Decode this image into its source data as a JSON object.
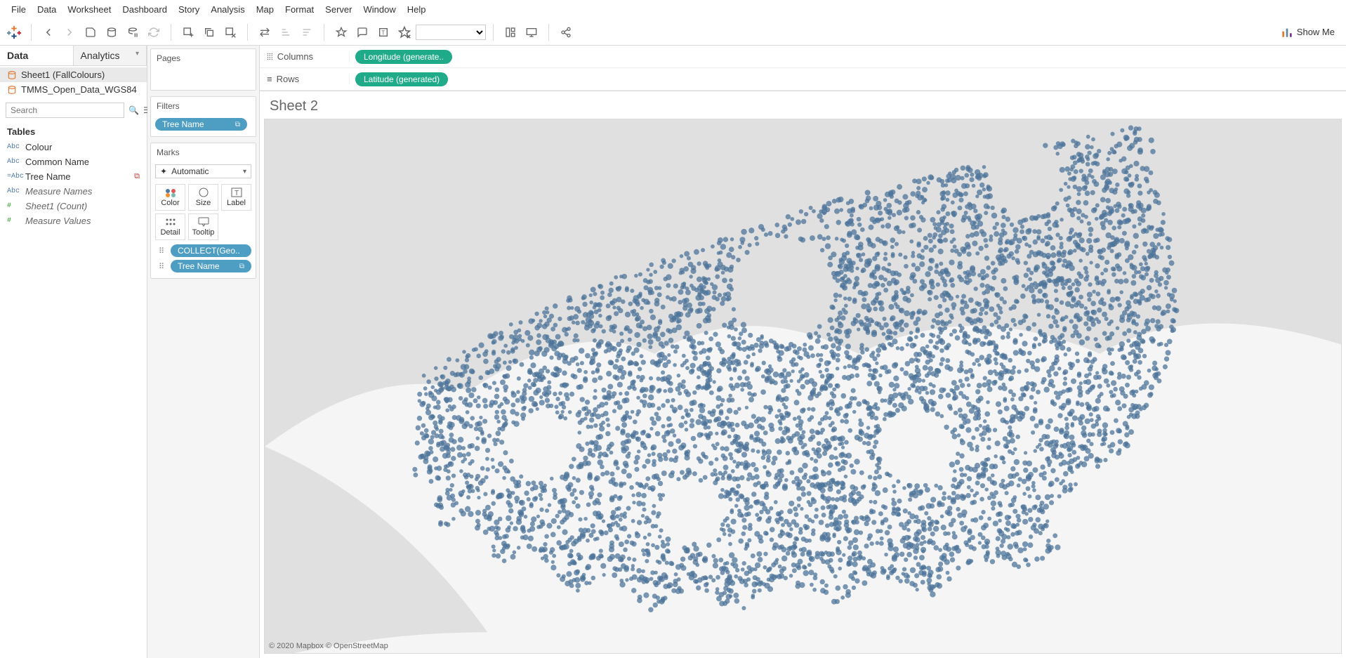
{
  "menu": [
    "File",
    "Data",
    "Worksheet",
    "Dashboard",
    "Story",
    "Analysis",
    "Map",
    "Format",
    "Server",
    "Window",
    "Help"
  ],
  "show_me": "Show Me",
  "left": {
    "tabs": {
      "data": "Data",
      "analytics": "Analytics"
    },
    "datasources": [
      {
        "label": "Sheet1 (FallColours)",
        "selected": true
      },
      {
        "label": "TMMS_Open_Data_WGS84",
        "selected": false
      }
    ],
    "search_placeholder": "Search",
    "tables_header": "Tables",
    "fields": [
      {
        "type": "Abc",
        "label": "Colour",
        "meas": false,
        "italic": false,
        "link": false
      },
      {
        "type": "Abc",
        "label": "Common Name",
        "meas": false,
        "italic": false,
        "link": false
      },
      {
        "type": "=Abc",
        "label": "Tree Name",
        "meas": false,
        "italic": false,
        "link": true
      },
      {
        "type": "Abc",
        "label": "Measure Names",
        "meas": false,
        "italic": true,
        "link": false
      },
      {
        "type": "#",
        "label": "Sheet1 (Count)",
        "meas": true,
        "italic": true,
        "link": false
      },
      {
        "type": "#",
        "label": "Measure Values",
        "meas": true,
        "italic": true,
        "link": false
      }
    ]
  },
  "mid": {
    "pages": "Pages",
    "filters": "Filters",
    "filter_pill": "Tree Name",
    "marks": "Marks",
    "marks_type": "Automatic",
    "mark_cells": {
      "color": "Color",
      "size": "Size",
      "label": "Label",
      "detail": "Detail",
      "tooltip": "Tooltip"
    },
    "mark_pills": [
      {
        "label": "COLLECT(Geo..",
        "icon": "detail"
      },
      {
        "label": "Tree Name",
        "icon": "detail"
      }
    ]
  },
  "shelves": {
    "columns_label": "Columns",
    "rows_label": "Rows",
    "columns_pill": "Longitude (generate..",
    "rows_pill": "Latitude (generated)"
  },
  "viz": {
    "title": "Sheet 2",
    "attribution": "© 2020 Mapbox © OpenStreetMap",
    "dot_color": "#4e749a",
    "land_color": "#e0e0e0",
    "water_color": "#f5f5f5"
  }
}
